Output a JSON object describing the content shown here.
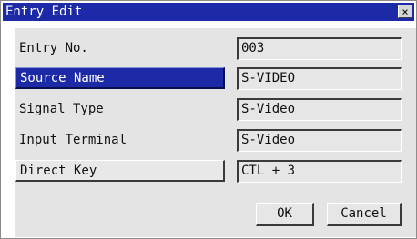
{
  "window": {
    "title": "Entry Edit",
    "close_glyph": "×"
  },
  "rows": [
    {
      "label": "Entry No.",
      "value": "003"
    },
    {
      "label": "Source Name",
      "value": "S-VIDEO"
    },
    {
      "label": "Signal Type",
      "value": "S-Video"
    },
    {
      "label": "Input Terminal",
      "value": "S-Video"
    },
    {
      "label": "Direct Key",
      "value": "CTL + 3"
    }
  ],
  "buttons": {
    "ok": "OK",
    "cancel": "Cancel"
  },
  "colors": {
    "title_bar": "#1d2aa8",
    "selected": "#1d2aa8",
    "panel": "#e4e4e4"
  }
}
